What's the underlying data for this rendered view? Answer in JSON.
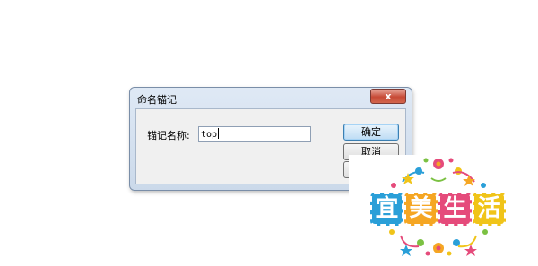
{
  "dialog": {
    "title": "命名锚记",
    "close_label": "x",
    "field_label": "锚记名称:",
    "input_value": "top",
    "ok_label": "确定",
    "cancel_label": "取消",
    "help_label": ""
  },
  "watermark": {
    "text": [
      "宜",
      "美",
      "生",
      "活"
    ]
  },
  "colors": {
    "dialog_frame": "#cbd9ea",
    "close_button": "#c74a36",
    "default_button": "#bedcf4",
    "logo_blue": "#2a9fd8",
    "logo_orange": "#f5a623",
    "logo_pink": "#e54b7b",
    "logo_yellow": "#f0c419"
  }
}
